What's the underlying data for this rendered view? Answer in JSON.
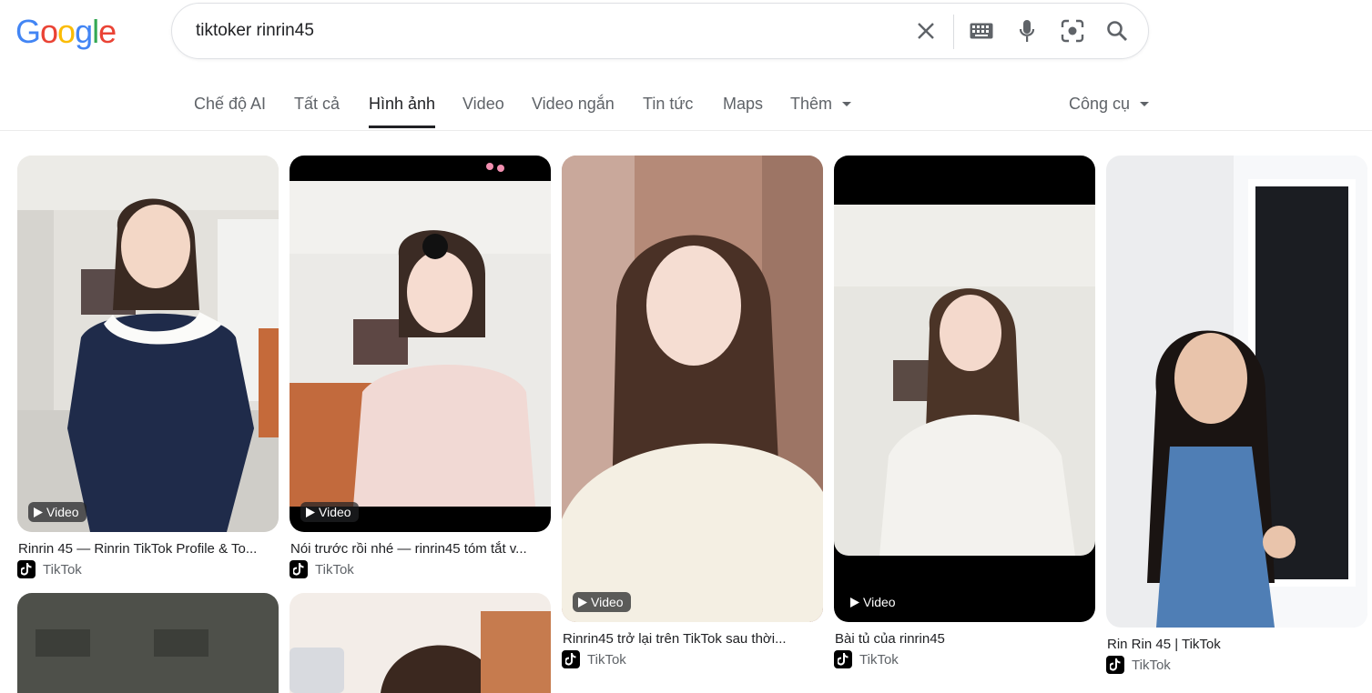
{
  "logo": "Google",
  "search": {
    "value": "tiktoker rinrin45"
  },
  "tabs": [
    {
      "label": "Chế độ AI"
    },
    {
      "label": "Tất cả"
    },
    {
      "label": "Hình ảnh"
    },
    {
      "label": "Video"
    },
    {
      "label": "Video ngắn"
    },
    {
      "label": "Tin tức"
    },
    {
      "label": "Maps"
    },
    {
      "label": "Thêm"
    }
  ],
  "tools_label": "Công cụ",
  "results": [
    {
      "title": "Rinrin 45 — Rinrin TikTok Profile & To...",
      "source": "TikTok",
      "badge": "Video"
    },
    {
      "title": "Nói trước rồi nhé — rinrin45 tóm tắt v...",
      "source": "TikTok",
      "badge": "Video"
    },
    {
      "title": "Rinrin45 trở lại trên TikTok sau thời...",
      "source": "TikTok",
      "badge": "Video"
    },
    {
      "title": "Bài tủ của rinrin45",
      "source": "TikTok",
      "badge": "Video"
    },
    {
      "title": "Rin Rin 45 | TikTok",
      "source": "TikTok",
      "badge": ""
    }
  ],
  "colors": {
    "google_blue": "#4285F4",
    "google_red": "#EA4335",
    "google_yellow": "#FBBC05",
    "google_green": "#34A853"
  }
}
